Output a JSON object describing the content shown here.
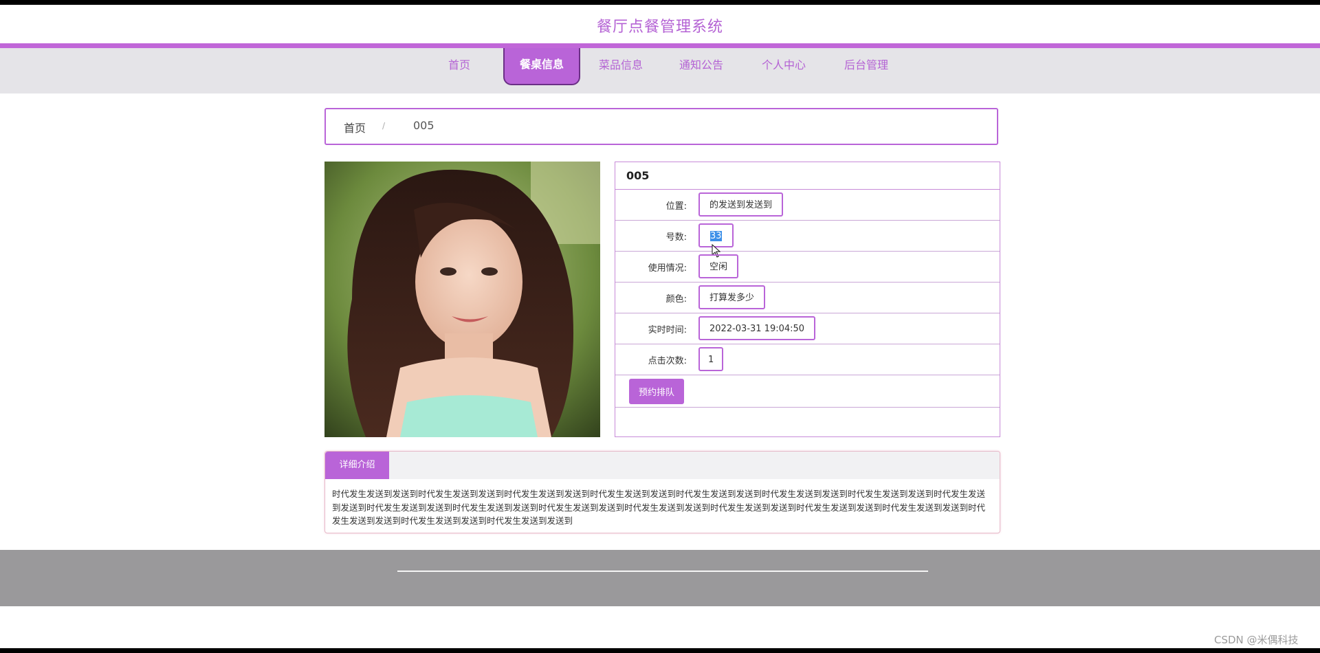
{
  "header": {
    "title": "餐厅点餐管理系统"
  },
  "nav": {
    "items": [
      {
        "label": "首页"
      },
      {
        "label": "餐桌信息"
      },
      {
        "label": "菜品信息"
      },
      {
        "label": "通知公告"
      },
      {
        "label": "个人中心"
      },
      {
        "label": "后台管理"
      }
    ],
    "active_index": 1
  },
  "breadcrumb": {
    "home": "首页",
    "separator": "/",
    "current": "005"
  },
  "detail": {
    "title": "005",
    "fields": [
      {
        "label": "位置:",
        "value": "的发送到发送到"
      },
      {
        "label": "号数:",
        "value": "33"
      },
      {
        "label": "使用情况:",
        "value": "空闲"
      },
      {
        "label": "颜色:",
        "value": "打算发多少"
      },
      {
        "label": "实时时间:",
        "value": "2022-03-31 19:04:50"
      },
      {
        "label": "点击次数:",
        "value": "1"
      }
    ],
    "reserve_button": "预约排队"
  },
  "intro": {
    "tab_label": "详细介绍",
    "text": "时代发生发送到发送到时代发生发送到发送到时代发生发送到发送到时代发生发送到发送到时代发生发送到发送到时代发生发送到发送到时代发生发送到发送到时代发生发送到发送到时代发生发送到发送到时代发生发送到发送到时代发生发送到发送到时代发生发送到发送到时代发生发送到发送到时代发生发送到发送到时代发生发送到发送到时代发生发送到发送到时代发生发送到发送到时代发生发送到发送到"
  },
  "watermark": "CSDN @米偶科技",
  "colors": {
    "accent": "#b964d8",
    "title": "#b462d4",
    "nav_bg": "#e5e4e8",
    "footer_bg": "#9a999b"
  }
}
